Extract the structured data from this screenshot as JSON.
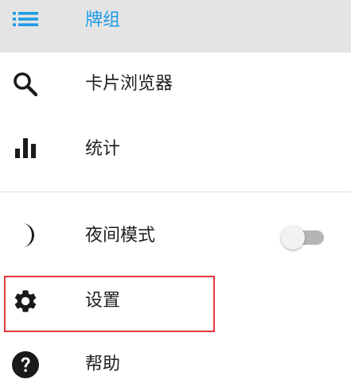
{
  "drawer": {
    "items": [
      {
        "id": "decks",
        "label": "牌组",
        "icon": "deck-list-icon",
        "selected": true
      },
      {
        "id": "browser",
        "label": "卡片浏览器",
        "icon": "search-icon"
      },
      {
        "id": "stats",
        "label": "统计",
        "icon": "bar-chart-icon"
      },
      {
        "id": "night_mode",
        "label": "夜间模式",
        "icon": "moon-icon",
        "toggle_on": false
      },
      {
        "id": "settings",
        "label": "设置",
        "icon": "gear-icon",
        "highlighted": true
      },
      {
        "id": "help",
        "label": "帮助",
        "icon": "help-icon"
      }
    ]
  },
  "colors": {
    "accent": "#1e9be6",
    "selected_bg": "#e4e4e4",
    "highlight_border": "#e0393e",
    "divider": "#dcdcdc",
    "toggle_track": "#b5b5b5",
    "toggle_thumb": "#f2f2f2"
  }
}
